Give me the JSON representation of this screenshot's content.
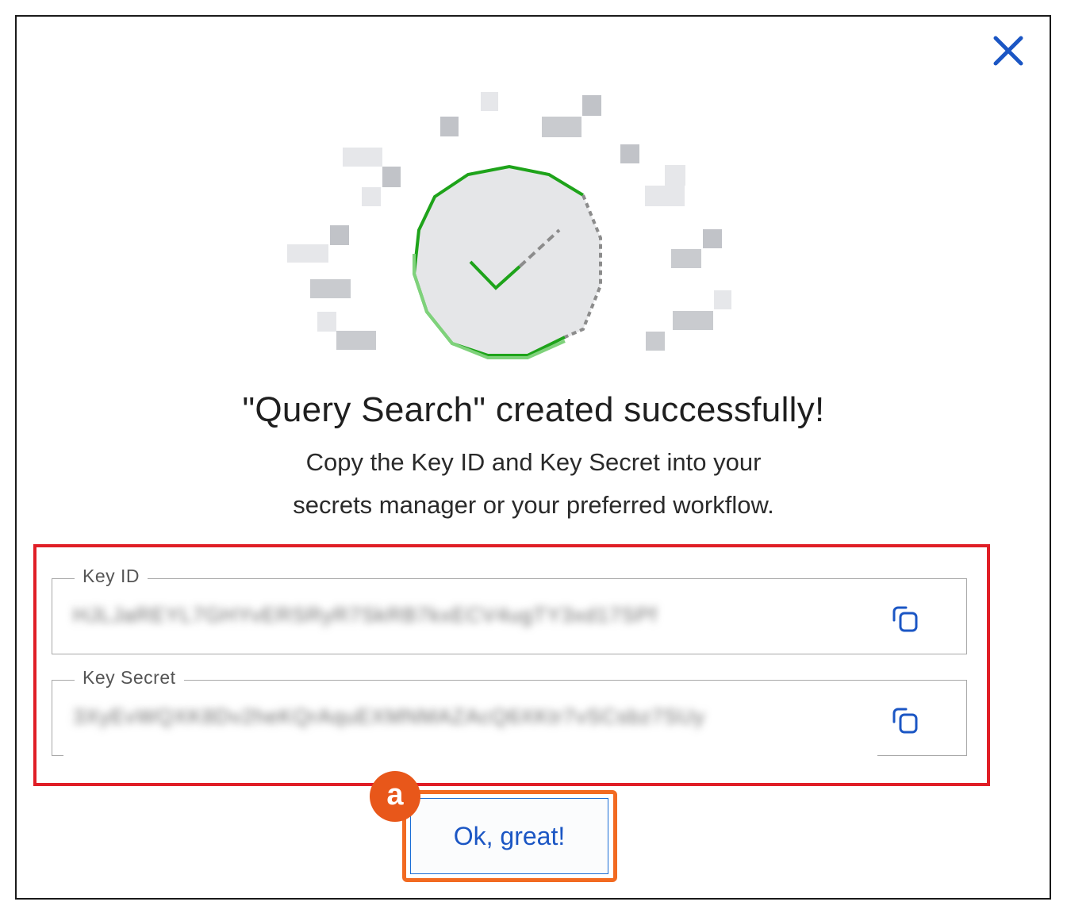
{
  "dialog": {
    "title": "\"Query Search\" created successfully!",
    "description_line1": "Copy the Key ID and Key Secret into your",
    "description_line2": "secrets manager or your preferred workflow."
  },
  "fields": {
    "key_id": {
      "label": "Key ID",
      "value": "HJLJaREYL7GHYvERSRyR7SkRB7kxECV4ugTY3xd17SPf"
    },
    "key_secret": {
      "label": "Key Secret",
      "value": "3XyEvWQXK8Dv2heKQrAquEXMNMAZAcQ6XKtr7vSCsbz7SUy"
    }
  },
  "actions": {
    "confirm_label": "Ok, great!"
  },
  "annotation": {
    "badge_label": "a"
  },
  "colors": {
    "success_green": "#1ea31a",
    "primary_blue": "#1b56c4",
    "highlight_red": "#e01e26",
    "highlight_orange": "#f26a21"
  }
}
